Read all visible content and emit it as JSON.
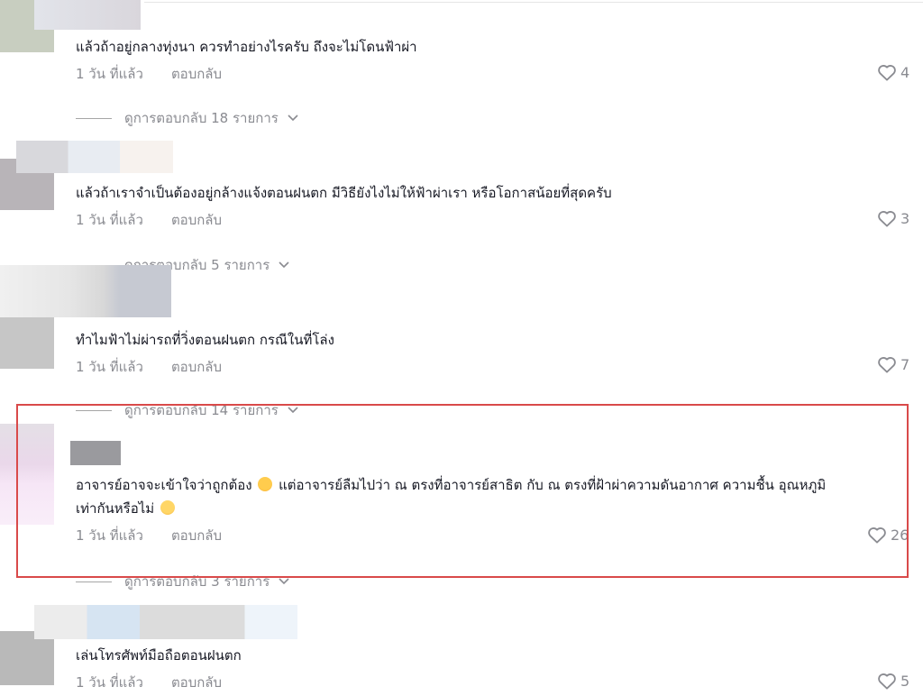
{
  "comments": [
    {
      "text": "แล้วถ้าอยู่กลางทุ่งนา ควรทำอย่างไรครับ ถึงจะไม่โดนฟ้าผ่า",
      "time": "1 วัน ที่แล้ว",
      "reply": "ตอบกลับ",
      "likes": "4",
      "view_replies": "ดูการตอบกลับ 18 รายการ"
    },
    {
      "text": "แล้วถ้าเราจำเป็นต้องอยู่กล้างแจ้งตอนฝนตก มีวิธียังไงไม่ให้ฟ้าผ่าเรา หรือโอกาสน้อยที่สุดครับ",
      "time": "1 วัน ที่แล้ว",
      "reply": "ตอบกลับ",
      "likes": "3",
      "view_replies": "ดูการตอบกลับ 5 รายการ"
    },
    {
      "text": "ทำไมฟ้าไม่ผ่ารถที่วิ่งตอนฝนตก กรณีในที่โล่ง",
      "time": "1 วัน ที่แล้ว",
      "reply": "ตอบกลับ",
      "likes": "7",
      "view_replies": "ดูการตอบกลับ 14 รายการ"
    },
    {
      "text_line1": "อาจารย์อาจจะเข้าใจว่าถูกต้อง",
      "text_line1b": "แต่อาจารย์ลืมไปว่า ณ ตรงที่อาจารย์สาธิต กับ ณ ตรงที่ฝ้าผ่าความดันอากาศ ความชื้น อุณหภูมิ",
      "text_line2": "เท่ากันหรือไม่",
      "time": "1 วัน ที่แล้ว",
      "reply": "ตอบกลับ",
      "likes": "26",
      "view_replies": "ดูการตอบกลับ 3 รายการ"
    },
    {
      "text": "เล่นโทรศัพท์มือถือตอนฝนตก",
      "time": "1 วัน ที่แล้ว",
      "reply": "ตอบกลับ",
      "likes": "5"
    }
  ],
  "icons": {
    "like": "heart-outline-icon",
    "expand": "chevron-down-icon",
    "emoji1": "disappointed-face-emoji",
    "emoji2": "thinking-face-emoji"
  },
  "colors": {
    "highlight": "#d94a4a",
    "muted": "#8a8b91",
    "text": "#161823"
  }
}
